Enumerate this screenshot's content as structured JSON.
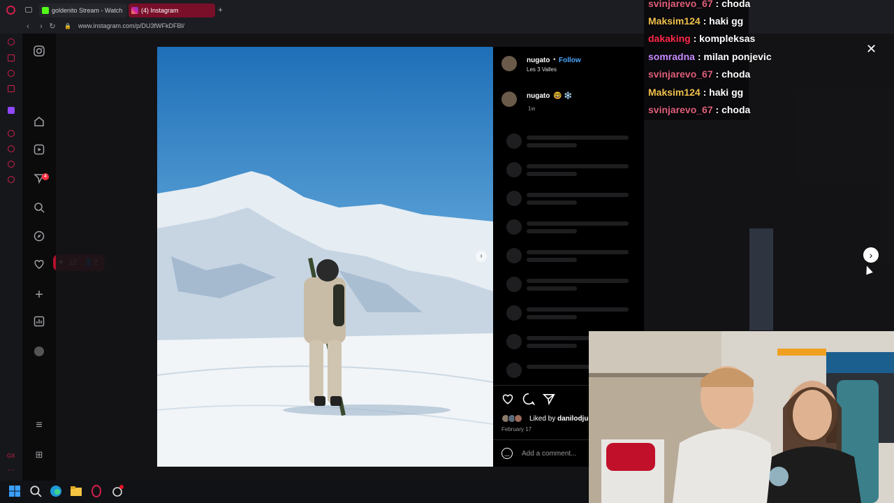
{
  "browser": {
    "tabs": [
      {
        "label": "goldenito Stream - Watch",
        "icon": "kick-icon",
        "active": false
      },
      {
        "label": "(4) Instagram",
        "icon": "instagram-icon",
        "active": true
      }
    ],
    "url": "www.instagram.com/p/DU3fWFkDFBl/"
  },
  "instagram": {
    "notif_badge": "4",
    "activity_popup": {
      "likes": "12",
      "followers": "2"
    },
    "post": {
      "username": "nugato",
      "follow_label": "Follow",
      "location": "Les 3 Valles",
      "caption_user": "nugato",
      "caption_emoji": "🤓 ❄️",
      "caption_time": "1w",
      "liked_by_prefix": "Liked by",
      "liked_by_user": "danilodju",
      "date": "February 17",
      "comment_placeholder": "Add a comment..."
    }
  },
  "chat": {
    "messages": [
      {
        "user": "svinjarevo_67",
        "text": ": choda",
        "color": "#e0607a"
      },
      {
        "user": "Maksim124",
        "text": ": haki gg",
        "color": "#f2c14e"
      },
      {
        "user": "dakaking",
        "text": ": kompleksas",
        "color": "#ff2a4a"
      },
      {
        "user": "somradna",
        "text": ": milan ponjevic",
        "color": "#c78bff"
      },
      {
        "user": "svinjarevo_67",
        "text": ": choda",
        "color": "#e0607a"
      },
      {
        "user": "Maksim124",
        "text": ": haki gg",
        "color": "#f2c14e"
      },
      {
        "user": "svinjarevo_67",
        "text": ": choda",
        "color": "#e0607a"
      }
    ]
  },
  "colors": {
    "accent": "#d0204a",
    "follow": "#4aa8ff",
    "bg": "#0f0f10"
  }
}
